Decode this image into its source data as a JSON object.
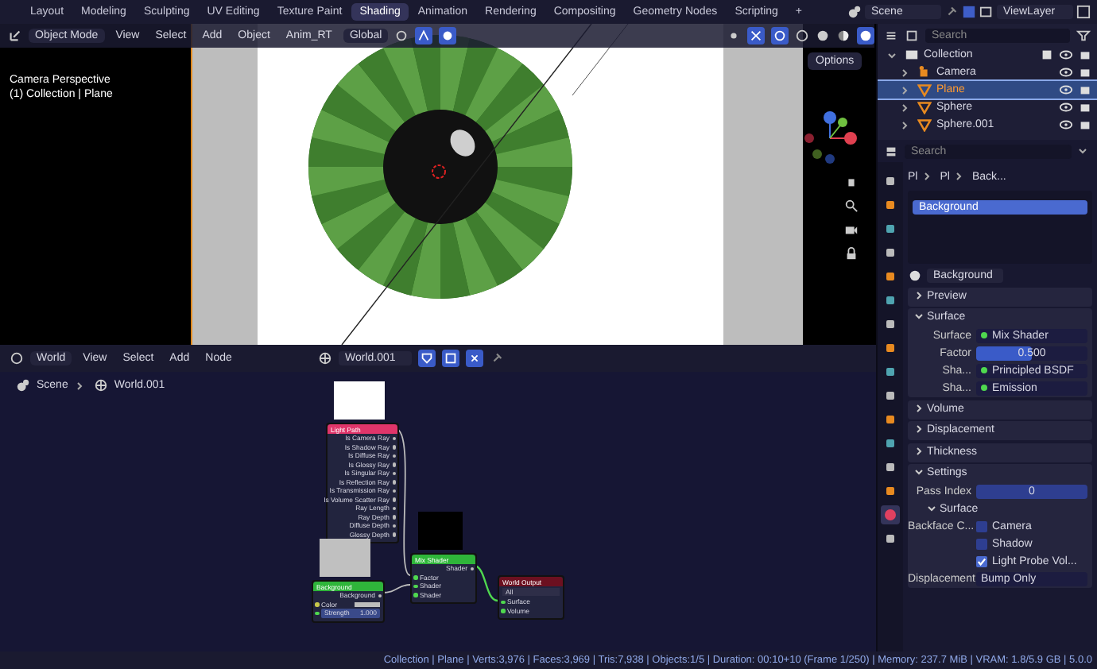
{
  "topbar": {
    "tabs": [
      {
        "label": "Layout",
        "selected": false
      },
      {
        "label": "Modeling",
        "selected": false
      },
      {
        "label": "Sculpting",
        "selected": false
      },
      {
        "label": "UV Editing",
        "selected": false
      },
      {
        "label": "Texture Paint",
        "selected": false
      },
      {
        "label": "Shading",
        "selected": true
      },
      {
        "label": "Animation",
        "selected": false
      },
      {
        "label": "Rendering",
        "selected": false
      },
      {
        "label": "Compositing",
        "selected": false
      },
      {
        "label": "Geometry Nodes",
        "selected": false
      },
      {
        "label": "Scripting",
        "selected": false
      }
    ],
    "add_tab": "+",
    "scene": "Scene",
    "view_layer": "ViewLayer"
  },
  "viewport": {
    "mode": "Object Mode",
    "menus": [
      "View",
      "Select",
      "Add",
      "Object",
      "Anim_RT"
    ],
    "orientation": "Global",
    "overlay_title": "Camera Perspective",
    "overlay_subtitle": "(1) Collection | Plane",
    "options": "Options"
  },
  "node_editor": {
    "type": "World",
    "menus": [
      "View",
      "Select",
      "Add",
      "Node"
    ],
    "world": "World.001",
    "breadcrumb": [
      "Scene",
      "World.001"
    ],
    "nodes": [
      {
        "kind": "light_path",
        "title": "Light Path",
        "outputs": [
          "Is Camera Ray",
          "Is Shadow Ray",
          "Is Diffuse Ray",
          "Is Glossy Ray",
          "Is Singular Ray",
          "Is Reflection Ray",
          "Is Transmission Ray",
          "Is Volume Scatter Ray",
          "Ray Length",
          "Ray Depth",
          "Diffuse Depth",
          "Glossy Depth"
        ]
      },
      {
        "kind": "background",
        "title": "Background",
        "outputs": [
          "Background"
        ],
        "inputs": [
          "Color",
          "Strength"
        ],
        "strength": "1.000"
      },
      {
        "kind": "mix_shader",
        "title": "Mix Shader",
        "outputs": [
          "Shader"
        ],
        "inputs": [
          "Factor",
          "Shader",
          "Shader"
        ]
      },
      {
        "kind": "world_output",
        "title": "World Output",
        "inputs": [
          "Surface",
          "Volume"
        ],
        "target": "All"
      }
    ]
  },
  "outliner": {
    "search_placeholder": "Search",
    "collection": "Collection",
    "items": [
      {
        "name": "Camera",
        "kind": "camera",
        "selected": false
      },
      {
        "name": "Plane",
        "kind": "mesh",
        "selected": true
      },
      {
        "name": "Sphere",
        "kind": "mesh",
        "selected": false
      },
      {
        "name": "Sphere.001",
        "kind": "mesh",
        "selected": false
      }
    ]
  },
  "properties": {
    "search_placeholder": "Search",
    "tabs": [
      {
        "selected": false
      },
      {
        "selected": false
      },
      {
        "selected": false
      },
      {
        "selected": false
      },
      {
        "selected": false
      },
      {
        "selected": false
      },
      {
        "selected": false
      },
      {
        "selected": false
      },
      {
        "selected": false
      },
      {
        "selected": false
      },
      {
        "selected": false
      },
      {
        "selected": false
      },
      {
        "selected": false
      },
      {
        "selected": false
      },
      {
        "selected": true
      },
      {
        "selected": false
      }
    ],
    "breadcrumb": [
      "Pl",
      "Pl",
      "Back..."
    ],
    "world_list": [
      {
        "name": "Background",
        "selected": true
      }
    ],
    "world_name": "Background",
    "preview": {
      "title": "Preview",
      "expanded": false
    },
    "surface": {
      "title": "Surface",
      "expanded": true,
      "surface_label": "Surface",
      "surface_value": "Mix Shader",
      "factor_label": "Factor",
      "factor_value": "0.500",
      "level": 0.5,
      "shader_rows": [
        {
          "label": "Sha...",
          "value": "Principled BSDF"
        },
        {
          "label": "Sha...",
          "value": "Emission"
        }
      ]
    },
    "collapsed_panels": [
      {
        "title": "Volume",
        "expanded": false
      },
      {
        "title": "Displacement",
        "expanded": false
      },
      {
        "title": "Thickness",
        "expanded": false
      }
    ],
    "settings": {
      "title": "Settings",
      "expanded": true,
      "pass_index_label": "Pass Index",
      "pass_index": "0",
      "sub_title": "Surface",
      "backface_label": "Backface C...",
      "checks": [
        {
          "label": "Camera",
          "checked": false
        },
        {
          "label": "Shadow",
          "checked": false
        },
        {
          "label": "Light Probe Vol...",
          "checked": true
        }
      ],
      "displacement_label": "Displacement",
      "displacement_value": "Bump Only"
    }
  },
  "status_bar": {
    "text": "Collection | Plane | Verts:3,976 | Faces:3,969 | Tris:7,938 | Objects:1/5 | Duration: 00:10+10 (Frame 1/250) | Memory: 237.7 MiB | VRAM: 1.8/5.9 GB | 5.0.0"
  }
}
